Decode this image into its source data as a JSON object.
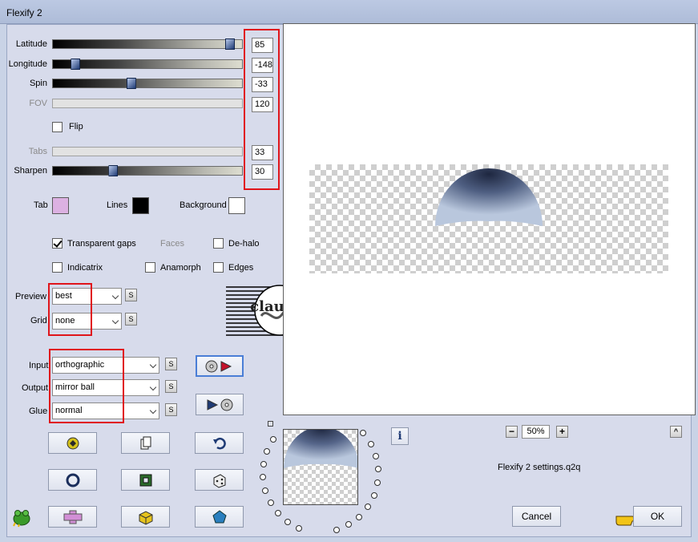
{
  "window": {
    "title": "Flexify 2"
  },
  "sliders": [
    {
      "label": "Latitude",
      "value": "85",
      "level": 0.96,
      "disabled": false
    },
    {
      "label": "Longitude",
      "value": "-148",
      "level": 0.1,
      "disabled": false
    },
    {
      "label": "Spin",
      "value": "-33",
      "level": 0.41,
      "disabled": false
    },
    {
      "label": "FOV",
      "value": "120",
      "level": null,
      "disabled": true
    },
    {
      "label": "Tabs",
      "value": "33",
      "level": null,
      "disabled": true
    },
    {
      "label": "Sharpen",
      "value": "30",
      "level": 0.31,
      "disabled": false
    }
  ],
  "flip": {
    "label": "Flip",
    "checked": false
  },
  "colors": {
    "tab_label": "Tab",
    "tab_color": "#dcb1e2",
    "lines_label": "Lines",
    "lines_color": "#000000",
    "background_label": "Background",
    "background_color": "#ffffff",
    "highlight": "#e0151b"
  },
  "options": {
    "transparent_gaps": {
      "label": "Transparent gaps",
      "checked": true
    },
    "faces": {
      "label": "Faces",
      "checked": false
    },
    "dehalo": {
      "label": "De-halo",
      "checked": false
    },
    "indicatrix": {
      "label": "Indicatrix",
      "checked": false
    },
    "anamorph": {
      "label": "Anamorph",
      "checked": false
    },
    "edges": {
      "label": "Edges",
      "checked": false
    }
  },
  "preview_select": {
    "label": "Preview",
    "value": "best"
  },
  "grid_select": {
    "label": "Grid",
    "value": "none"
  },
  "input_select": {
    "label": "Input",
    "value": "orthographic"
  },
  "output_select": {
    "label": "Output",
    "value": "mirror ball"
  },
  "glue_select": {
    "label": "Glue",
    "value": "normal"
  },
  "small_button_label": "S",
  "watermark": {
    "text": "claudia"
  },
  "zoom": {
    "value": "50%",
    "minus": "−",
    "plus": "+"
  },
  "info_label": "i",
  "settings_file": "Flexify 2 settings.q2q",
  "buttons": {
    "cancel": "Cancel",
    "ok": "OK"
  },
  "icons": [
    "random-icon",
    "copy-icon",
    "undo-icon",
    "ring-icon",
    "square-frame-icon",
    "dice-icon",
    "plus-shape-icon",
    "box-icon",
    "pentagon-icon"
  ]
}
